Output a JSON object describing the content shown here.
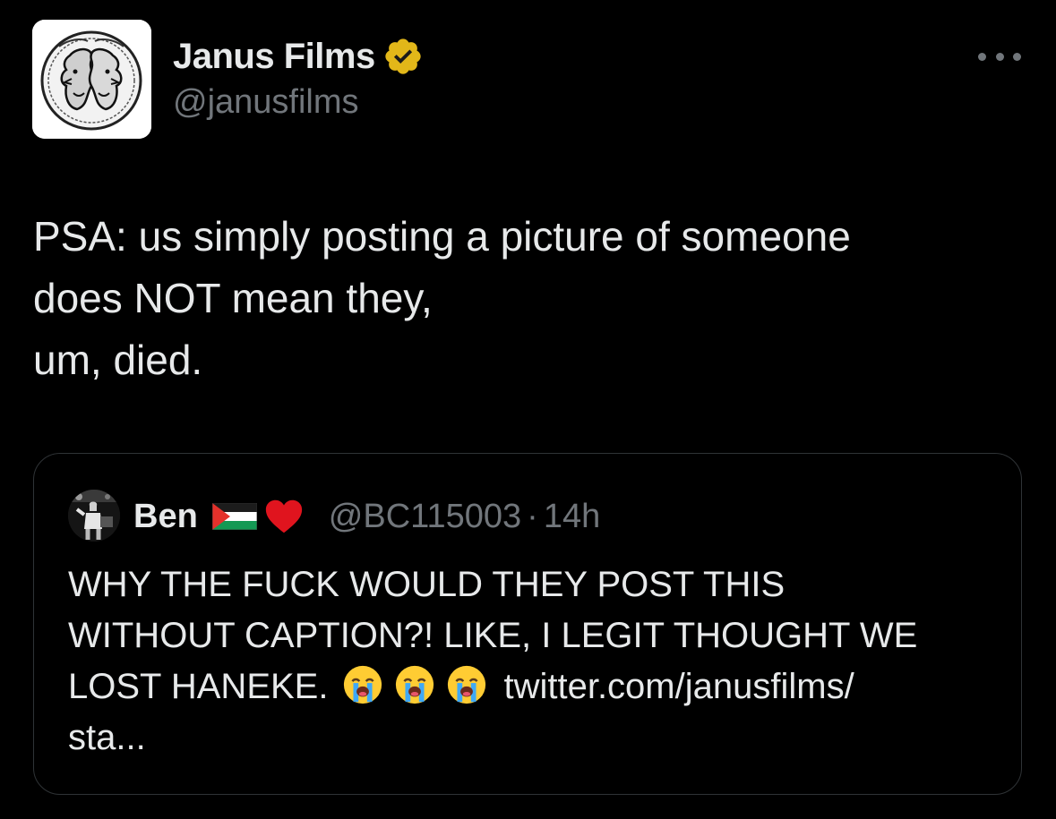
{
  "author": {
    "display_name": "Janus Films",
    "handle": "@janusfilms",
    "verified_color": "#e2b719",
    "avatar_icon": "janus-coin-logo"
  },
  "more_icon": "more-horizontal-icon",
  "tweet": {
    "lines": [
      "PSA: us simply posting a picture of someone",
      "does NOT mean they,",
      "um, died."
    ]
  },
  "quoted": {
    "display_name": "Ben",
    "handle": "@BC115003",
    "separator": "·",
    "time": "14h",
    "name_icons": [
      "palestine-flag-icon",
      "red-heart-icon"
    ],
    "lines": [
      "WHY THE FUCK WOULD THEY POST THIS",
      "WITHOUT CAPTION?! LIKE, I LEGIT THOUGHT WE",
      "LOST HANEKE.",
      "sta..."
    ],
    "emojis": [
      "loudly-crying-face-icon",
      "loudly-crying-face-icon",
      "loudly-crying-face-icon"
    ],
    "link_text": "twitter.com/janusfilms/"
  },
  "colors": {
    "background": "#000000",
    "text_primary": "#e7e9ea",
    "text_secondary": "#71767b",
    "border": "#2f3336"
  }
}
